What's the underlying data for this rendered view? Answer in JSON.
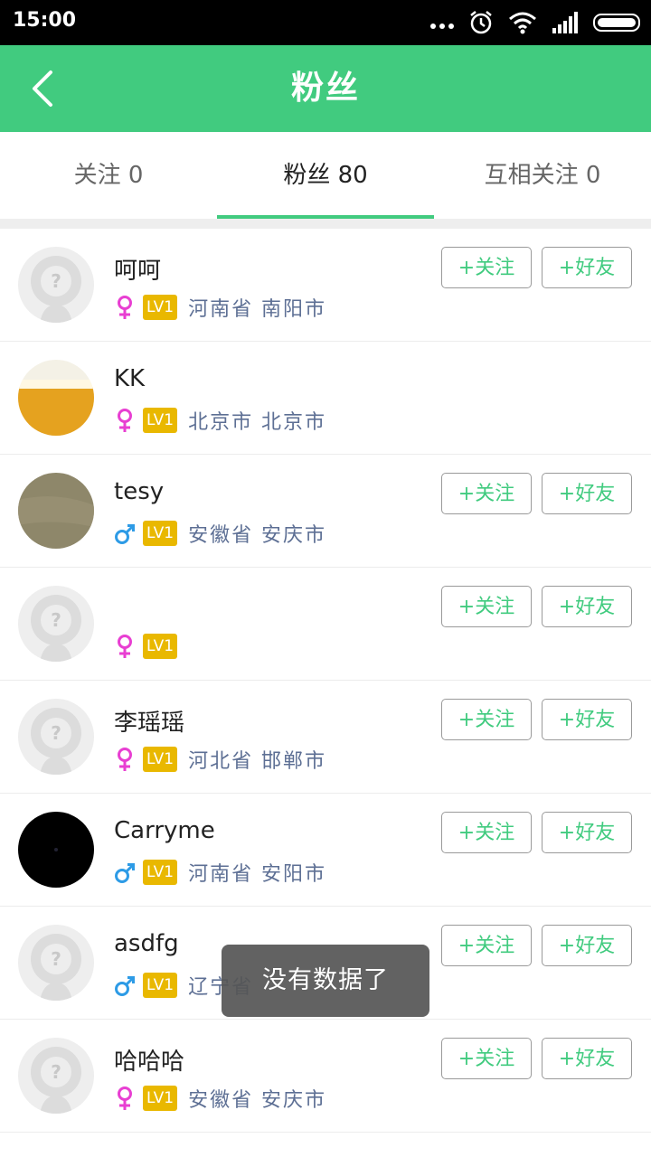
{
  "status_bar": {
    "time": "15:00"
  },
  "header": {
    "title": "粉丝"
  },
  "tabs": [
    {
      "label": "关注 0",
      "active": false
    },
    {
      "label": "粉丝 80",
      "active": true
    },
    {
      "label": "互相关注 0",
      "active": false
    }
  ],
  "buttons": {
    "follow": "+关注",
    "friend": "+好友"
  },
  "colors": {
    "accent": "#41cb7f",
    "badge": "#e9b800",
    "female": "#e83fd2",
    "male": "#2d9be6"
  },
  "users": [
    {
      "name": "呵呵",
      "gender": "female",
      "level": "LV1",
      "location": "河南省 南阳市",
      "avatar": "default",
      "show_buttons": true
    },
    {
      "name": "KK",
      "gender": "female",
      "level": "LV1",
      "location": "北京市 北京市",
      "avatar": "beer",
      "show_buttons": false
    },
    {
      "name": "tesy",
      "gender": "male",
      "level": "LV1",
      "location": "安徽省 安庆市",
      "avatar": "khaki",
      "show_buttons": true
    },
    {
      "name": "",
      "gender": "female",
      "level": "LV1",
      "location": "",
      "avatar": "default",
      "show_buttons": true
    },
    {
      "name": "李瑶瑶",
      "gender": "female",
      "level": "LV1",
      "location": "河北省 邯郸市",
      "avatar": "default",
      "show_buttons": true
    },
    {
      "name": "Carryme",
      "gender": "male",
      "level": "LV1",
      "location": "河南省 安阳市",
      "avatar": "black",
      "show_buttons": true
    },
    {
      "name": "asdfg",
      "gender": "male",
      "level": "LV1",
      "location": "辽宁省",
      "avatar": "default",
      "show_buttons": true
    },
    {
      "name": "哈哈哈",
      "gender": "female",
      "level": "LV1",
      "location": "安徽省 安庆市",
      "avatar": "default",
      "show_buttons": true
    }
  ],
  "toast": "没有数据了"
}
